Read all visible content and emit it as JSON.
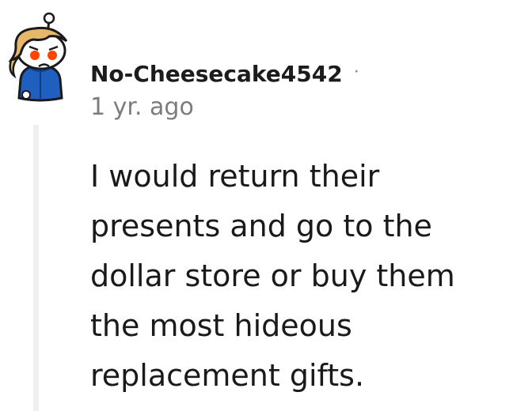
{
  "comment": {
    "author": "No-Cheesecake4542",
    "separator": "·",
    "timestamp": "1 yr. ago",
    "body_lines": [
      "I would return their",
      "presents and go to the",
      "dollar store or buy them",
      "the most hideous",
      "replacement gifts."
    ]
  },
  "avatar": {
    "icon": "snoo-avatar-icon",
    "colors": {
      "hair": "#e8b86a",
      "jacket": "#1f5fbf",
      "eyes": "#ff4500",
      "background": "#ffffff"
    }
  },
  "thread": {
    "line_color": "#edeff1"
  }
}
